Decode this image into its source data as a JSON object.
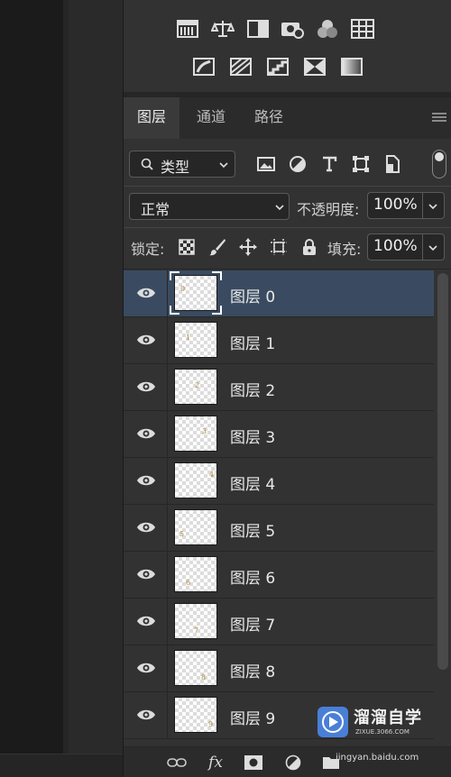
{
  "tabs": [
    {
      "label": "图层",
      "active": true
    },
    {
      "label": "通道",
      "active": false
    },
    {
      "label": "路径",
      "active": false
    }
  ],
  "adjustment_icons_row1": [
    "levels-icon",
    "balance-icon",
    "black-white-icon",
    "photo-filter-icon",
    "channel-mixer-icon",
    "color-lookup-icon"
  ],
  "adjustment_icons_row2": [
    "invert-icon",
    "posterize-icon",
    "threshold-icon",
    "selective-color-icon",
    "gradient-map-icon"
  ],
  "filter": {
    "type_label": "类型",
    "icons": [
      "image-filter-icon",
      "adjustment-filter-icon",
      "type-filter-icon",
      "shape-filter-icon",
      "smart-object-filter-icon"
    ]
  },
  "blend": {
    "mode": "正常",
    "opacity_label": "不透明度:",
    "opacity_value": "100%"
  },
  "lock": {
    "label": "锁定:",
    "fill_label": "填充:",
    "fill_value": "100%"
  },
  "layers": [
    {
      "name": "图层 0",
      "selected": true,
      "glyph": "0"
    },
    {
      "name": "图层 1",
      "selected": false,
      "glyph": "1"
    },
    {
      "name": "图层 2",
      "selected": false,
      "glyph": "2"
    },
    {
      "name": "图层 3",
      "selected": false,
      "glyph": "3"
    },
    {
      "name": "图层 4",
      "selected": false,
      "glyph": "4"
    },
    {
      "name": "图层 5",
      "selected": false,
      "glyph": "5"
    },
    {
      "name": "图层 6",
      "selected": false,
      "glyph": "6"
    },
    {
      "name": "图层 7",
      "selected": false,
      "glyph": "7"
    },
    {
      "name": "图层 8",
      "selected": false,
      "glyph": "8"
    },
    {
      "name": "图层 9",
      "selected": false,
      "glyph": "9"
    }
  ],
  "bottom_bar": {
    "fx_label": "fx"
  },
  "watermark": {
    "title": "溜溜自学",
    "subtitle": "ZIXUE.3066.COM",
    "site": "jingyan.baidu.com"
  },
  "colors": {
    "selected_row": "#3a4b61",
    "panel_bg": "#323232",
    "accent": "#4a7fd8"
  }
}
